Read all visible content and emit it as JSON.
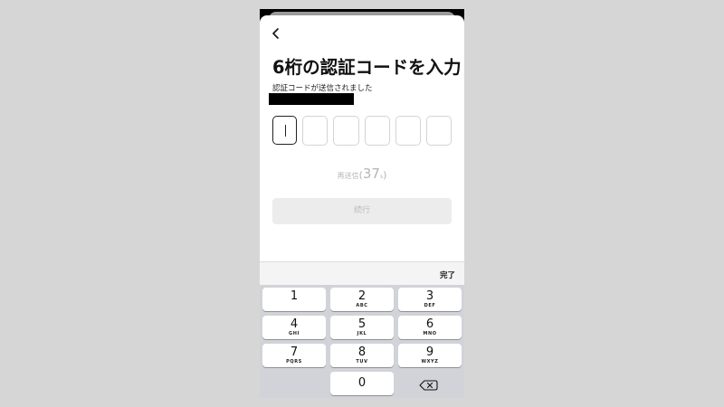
{
  "header": {
    "title": "6桁の認証コードを入力",
    "subtitle": "認証コードが送信されました"
  },
  "code": {
    "digits": [
      "",
      "",
      "",
      "",
      "",
      ""
    ],
    "active_index": 0
  },
  "resend": {
    "label": "再送信",
    "open_paren": "(",
    "countdown": "37",
    "unit": "s",
    "close_paren": ")"
  },
  "continue_button": {
    "label": "続行"
  },
  "keyboard": {
    "done_label": "完了",
    "keys": [
      {
        "num": "1",
        "letters": ""
      },
      {
        "num": "2",
        "letters": "ABC"
      },
      {
        "num": "3",
        "letters": "DEF"
      },
      {
        "num": "4",
        "letters": "GHI"
      },
      {
        "num": "5",
        "letters": "JKL"
      },
      {
        "num": "6",
        "letters": "MNO"
      },
      {
        "num": "7",
        "letters": "PQRS"
      },
      {
        "num": "8",
        "letters": "TUV"
      },
      {
        "num": "9",
        "letters": "WXYZ"
      }
    ],
    "zero": "0"
  },
  "icons": {
    "back": "chevron-left-icon",
    "backspace": "backspace-icon"
  },
  "colors": {
    "background": "#d6d6d6",
    "sheet": "#ffffff",
    "keypad": "#d1d3d9",
    "disabled_button": "#ececec",
    "disabled_text": "#bcbcbc",
    "active_border": "#222222"
  }
}
